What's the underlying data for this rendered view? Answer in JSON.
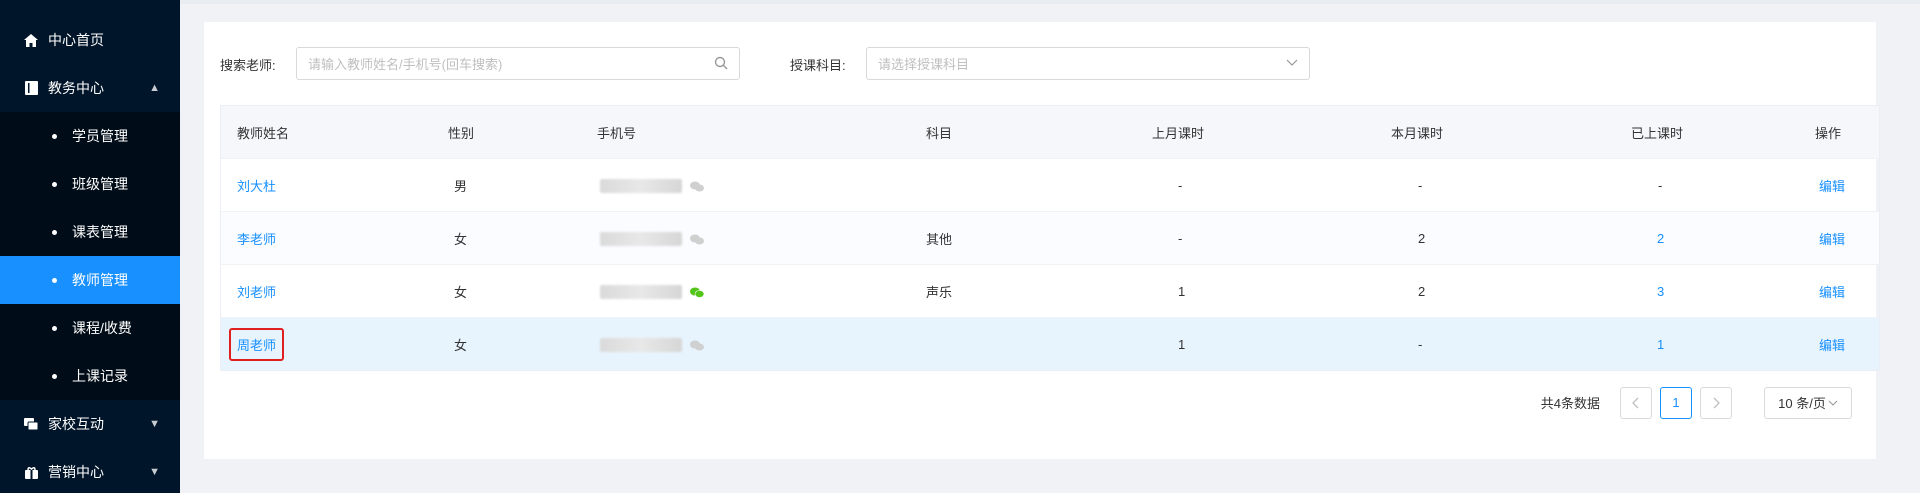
{
  "sidebar": {
    "items": [
      {
        "label": "中心首页",
        "icon": "home-icon"
      },
      {
        "label": "教务中心",
        "icon": "book-icon",
        "expanded": true
      },
      {
        "label": "家校互动",
        "icon": "chat-icon"
      },
      {
        "label": "营销中心",
        "icon": "gift-icon"
      }
    ],
    "sub_items": [
      {
        "label": "学员管理"
      },
      {
        "label": "班级管理"
      },
      {
        "label": "课表管理"
      },
      {
        "label": "教师管理",
        "active": true
      },
      {
        "label": "课程/收费"
      },
      {
        "label": "上课记录"
      }
    ]
  },
  "filter": {
    "teacher_label": "搜索老师:",
    "teacher_placeholder": "请输入教师姓名/手机号(回车搜索)",
    "subject_label": "授课科目:",
    "subject_placeholder": "请选择授课科目"
  },
  "table": {
    "headers": {
      "name": "教师姓名",
      "gender": "性别",
      "phone": "手机号",
      "subject": "科目",
      "last_month": "上月课时",
      "this_month": "本月课时",
      "taken": "已上课时",
      "action": "操作"
    },
    "rows": [
      {
        "name": "刘大杜",
        "gender": "男",
        "subject": "",
        "last_month": "-",
        "this_month": "-",
        "taken": "-",
        "action": "编辑",
        "wechat_bound": false
      },
      {
        "name": "李老师",
        "gender": "女",
        "subject": "其他",
        "last_month": "-",
        "this_month": "2",
        "taken": "2",
        "action": "编辑",
        "wechat_bound": false
      },
      {
        "name": "刘老师",
        "gender": "女",
        "subject": "声乐",
        "last_month": "1",
        "this_month": "2",
        "taken": "3",
        "action": "编辑",
        "wechat_bound": true
      },
      {
        "name": "周老师",
        "gender": "女",
        "subject": "",
        "last_month": "1",
        "this_month": "-",
        "taken": "1",
        "action": "编辑",
        "wechat_bound": false
      }
    ]
  },
  "pagination": {
    "total": "共4条数据",
    "current": "1",
    "page_size": "10 条/页"
  },
  "colors": {
    "accent": "#1890ff",
    "sidebar_bg": "#001529",
    "highlight_border": "#e02020",
    "wechat_green": "#52c41a"
  }
}
